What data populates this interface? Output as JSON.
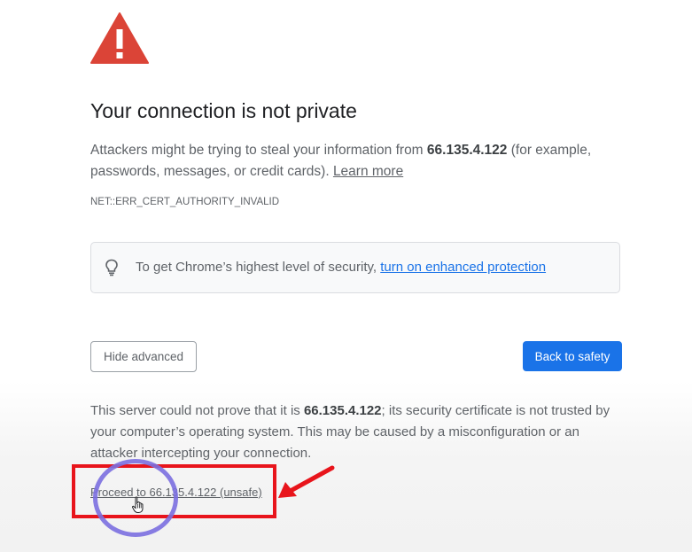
{
  "heading": "Your connection is not private",
  "main_message": {
    "prefix": "Attackers might be trying to steal your information from ",
    "host": "66.135.4.122",
    "suffix": " (for example, passwords, messages, or credit cards). ",
    "learn_more": "Learn more"
  },
  "error_code": "NET::ERR_CERT_AUTHORITY_INVALID",
  "enhanced_protection": {
    "text": "To get Chrome’s highest level of security, ",
    "link": "turn on enhanced protection",
    "icon": "lightbulb-icon"
  },
  "buttons": {
    "hide_advanced": "Hide advanced",
    "back_to_safety": "Back to safety"
  },
  "details": {
    "prefix": "This server could not prove that it is ",
    "host": "66.135.4.122",
    "suffix": "; its security certificate is not trusted by your computer’s operating system. This may be caused by a misconfiguration or an attacker intercepting your connection."
  },
  "proceed_link": "Proceed to 66.135.4.122 (unsafe)",
  "colors": {
    "warning_red": "#db4437",
    "primary_blue": "#1a73e8",
    "annotation_red": "#e8141b",
    "annotation_circle": "#7b6fe0"
  },
  "icons": [
    "warning-triangle-icon",
    "lightbulb-icon",
    "hand-cursor-icon",
    "arrow-annotation-icon"
  ]
}
